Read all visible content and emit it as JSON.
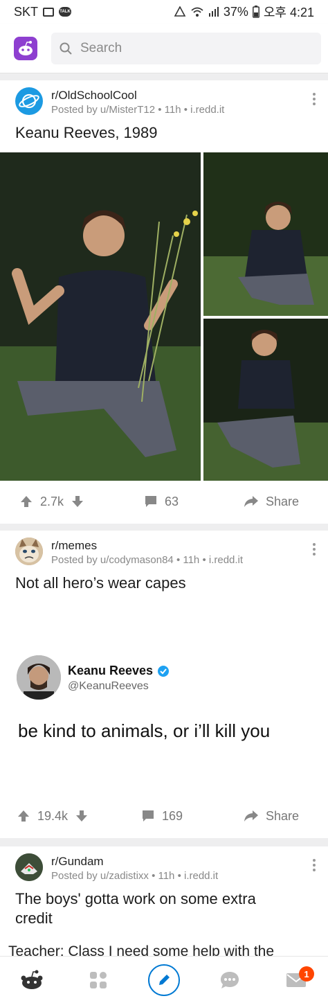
{
  "status_bar": {
    "carrier": "SKT",
    "talk_label": "TALK",
    "battery": "37%",
    "time": "오후 4:21"
  },
  "search": {
    "placeholder": "Search"
  },
  "posts": [
    {
      "subreddit": "r/OldSchoolCool",
      "meta": "Posted by u/MisterT12 • 11h • i.redd.it",
      "title": "Keanu Reeves, 1989",
      "upvotes": "2.7k",
      "comments": "63",
      "share": "Share"
    },
    {
      "subreddit": "r/memes",
      "meta": "Posted by u/codymason84 • 11h • i.redd.it",
      "title": "Not all hero’s wear capes",
      "tweet": {
        "name": "Keanu Reeves",
        "handle": "@KeanuReeves",
        "text": "be kind to animals, or i’ll kill you"
      },
      "upvotes": "19.4k",
      "comments": "169",
      "share": "Share"
    },
    {
      "subreddit": "r/Gundam",
      "meta": "Posted by u/zadistixx • 11h • i.redd.it",
      "title": "The boys' gotta work on some extra credit",
      "preview_text": "Teacher: Class I need some help with the"
    }
  ],
  "bottom_nav": {
    "inbox_badge": "1",
    "icons": [
      "home-icon",
      "communities-icon",
      "create-post-icon",
      "chat-icon",
      "inbox-icon"
    ]
  },
  "colors": {
    "accent": "#0079d3",
    "brand_purple": "#8e3fd0",
    "badge": "#ff4500"
  }
}
